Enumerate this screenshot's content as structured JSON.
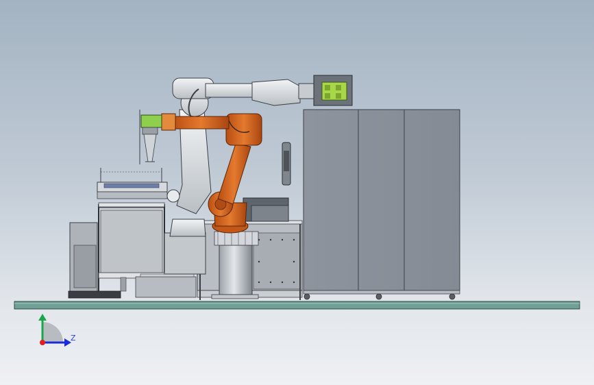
{
  "triad": {
    "z_label": "Z",
    "y_color": "#1aa64a",
    "z_color": "#1b2bd8",
    "origin_color": "#e02020"
  },
  "colors": {
    "floor_plate": "#6f9f95",
    "robot_white": "#d9dde0",
    "robot_orange": "#d9661e",
    "cabinet": "#8d939c",
    "gripper_green": "#a8d84a"
  }
}
